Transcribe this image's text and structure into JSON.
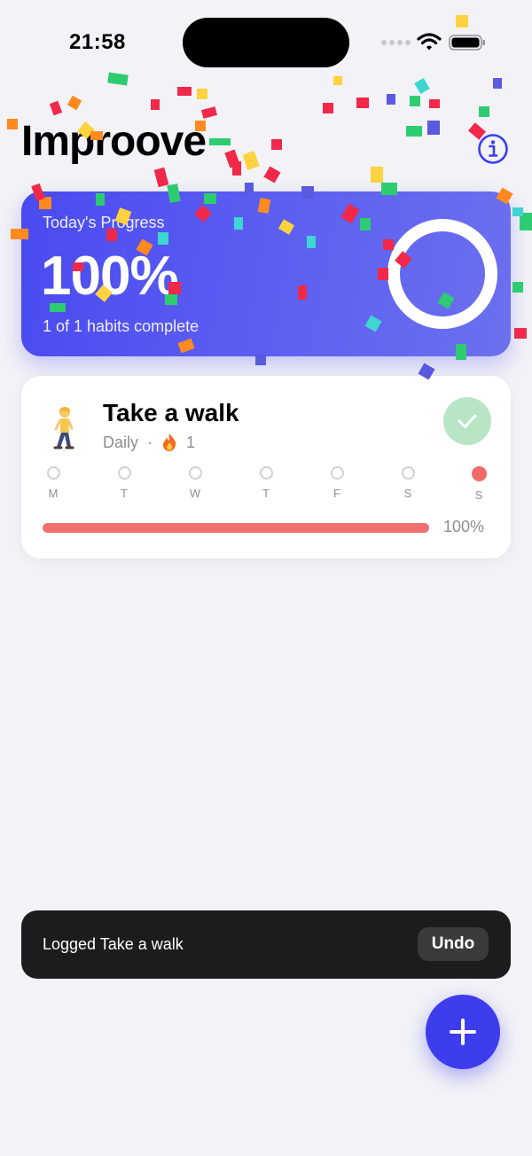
{
  "status": {
    "time": "21:58"
  },
  "app": {
    "title": "Improove"
  },
  "progress": {
    "label": "Today's Progress",
    "percent": "100%",
    "summary": "1 of 1 habits complete",
    "value": 1.0
  },
  "habits": [
    {
      "name": "Take a walk",
      "emoji": "person-walking",
      "frequency": "Daily",
      "separator": "·",
      "streak": "1",
      "completed": true,
      "week": [
        {
          "label": "M",
          "done": false
        },
        {
          "label": "T",
          "done": false
        },
        {
          "label": "W",
          "done": false
        },
        {
          "label": "T",
          "done": false
        },
        {
          "label": "F",
          "done": false
        },
        {
          "label": "S",
          "done": false
        },
        {
          "label": "S",
          "done": true
        }
      ],
      "progress_label": "100%",
      "progress_value": 1.0
    }
  ],
  "toast": {
    "message": "Logged Take a walk",
    "action": "Undo"
  },
  "colors": {
    "accent": "#3D3DEE",
    "card_gradient_start": "#4A4AF0",
    "card_gradient_end": "#6C70EE",
    "progress_bar": "#F07070",
    "check_bg": "#B8E6C4",
    "background": "#F2F2F7"
  },
  "icons": {
    "info": "info-circle-icon",
    "add": "plus-icon",
    "check": "checkmark-icon",
    "streak": "flame-icon"
  }
}
